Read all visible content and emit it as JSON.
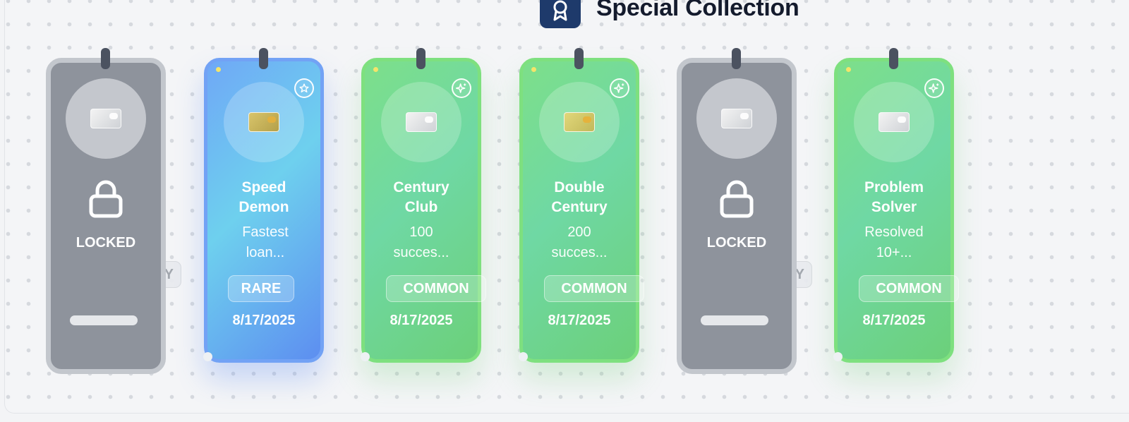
{
  "header": {
    "title": "Special Collection",
    "icon": "award-ribbon-icon"
  },
  "cards": [
    {
      "id": "locked-1",
      "state": "locked",
      "label": "LOCKED",
      "rarity_fragment": "RY"
    },
    {
      "id": "speed-demon",
      "state": "unlocked",
      "title": "Speed Demon",
      "description": "Fastest loan...",
      "rarity": "RARE",
      "date": "8/17/2025",
      "badge_icon": "star-icon"
    },
    {
      "id": "century-club",
      "state": "unlocked",
      "title": "Century Club",
      "description": "100 succes...",
      "rarity": "COMMON",
      "date": "8/17/2025",
      "badge_icon": "sparkle-icon"
    },
    {
      "id": "double-century",
      "state": "unlocked",
      "title": "Double Century",
      "description": "200 succes...",
      "rarity": "COMMON",
      "date": "8/17/2025",
      "badge_icon": "sparkle-icon"
    },
    {
      "id": "locked-2",
      "state": "locked",
      "label": "LOCKED",
      "rarity_fragment": "RY"
    },
    {
      "id": "problem-solver",
      "state": "unlocked",
      "title": "Problem Solver",
      "description": "Resolved 10+...",
      "rarity": "COMMON",
      "date": "8/17/2025",
      "badge_icon": "sparkle-icon"
    }
  ],
  "colors": {
    "rare": "#6ea9f6",
    "common": "#76dc86",
    "locked": "#8e939c",
    "header_badge": "#1e3a6b"
  }
}
